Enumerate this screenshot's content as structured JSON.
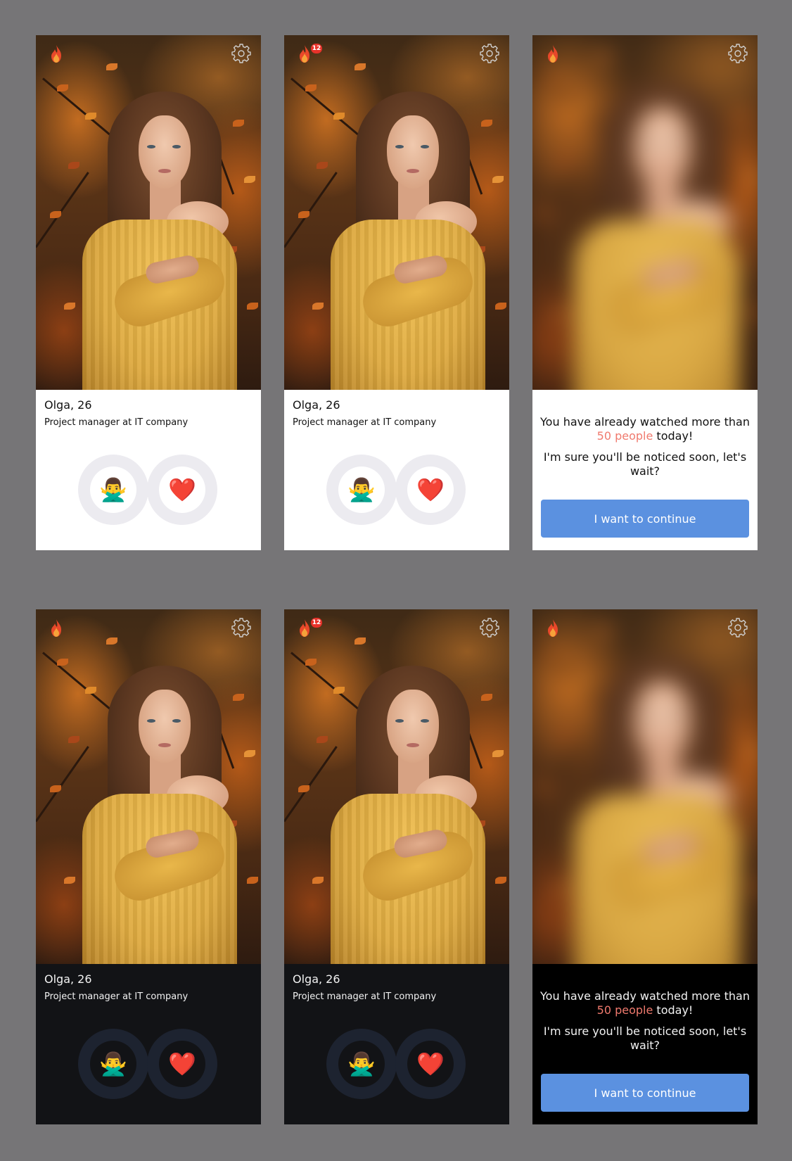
{
  "accent_color": "#5b91e0",
  "highlight_color": "#f07a6e",
  "badge_color": "#e8322a",
  "profile": {
    "name_age": "Olga, 26",
    "job": "Project manager at IT company"
  },
  "icons": {
    "flame": "flame-icon",
    "settings": "gear-icon",
    "dislike": "person-gesturing-no-emoji",
    "like": "red-heart-emoji"
  },
  "actions": {
    "dislike_emoji": "🙅‍♂️",
    "like_emoji": "❤️"
  },
  "notification_badge": "12",
  "limit": {
    "line_prefix": "You have already watched more than ",
    "highlight": "50 people",
    "line_suffix": " today!",
    "subline": "I'm sure you'll be noticed soon, let's wait?",
    "button_label": "I want to continue"
  }
}
